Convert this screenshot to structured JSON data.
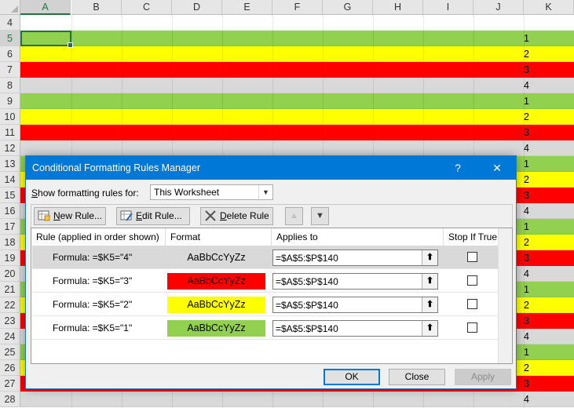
{
  "spreadsheet": {
    "columns": [
      "A",
      "B",
      "C",
      "D",
      "E",
      "F",
      "G",
      "H",
      "I",
      "J",
      "K"
    ],
    "selected_column": "A",
    "selected_row": "5",
    "rows": [
      {
        "num": "4",
        "fill": "#ffffff",
        "k": ""
      },
      {
        "num": "5",
        "fill": "#92d050",
        "k": "1"
      },
      {
        "num": "6",
        "fill": "#ffff00",
        "k": "2"
      },
      {
        "num": "7",
        "fill": "#ff0000",
        "k": "3"
      },
      {
        "num": "8",
        "fill": "#d9d9d9",
        "k": "4"
      },
      {
        "num": "9",
        "fill": "#92d050",
        "k": "1"
      },
      {
        "num": "10",
        "fill": "#ffff00",
        "k": "2"
      },
      {
        "num": "11",
        "fill": "#ff0000",
        "k": "3"
      },
      {
        "num": "12",
        "fill": "#d9d9d9",
        "k": "4"
      },
      {
        "num": "13",
        "fill": "#92d050",
        "k": "1"
      },
      {
        "num": "14",
        "fill": "#ffff00",
        "k": "2"
      },
      {
        "num": "15",
        "fill": "#ff0000",
        "k": "3"
      },
      {
        "num": "16",
        "fill": "#d9d9d9",
        "k": "4"
      },
      {
        "num": "17",
        "fill": "#92d050",
        "k": "1"
      },
      {
        "num": "18",
        "fill": "#ffff00",
        "k": "2"
      },
      {
        "num": "19",
        "fill": "#ff0000",
        "k": "3"
      },
      {
        "num": "20",
        "fill": "#d9d9d9",
        "k": "4"
      },
      {
        "num": "21",
        "fill": "#92d050",
        "k": "1"
      },
      {
        "num": "22",
        "fill": "#ffff00",
        "k": "2"
      },
      {
        "num": "23",
        "fill": "#ff0000",
        "k": "3"
      },
      {
        "num": "24",
        "fill": "#d9d9d9",
        "k": "4"
      },
      {
        "num": "25",
        "fill": "#92d050",
        "k": "1"
      },
      {
        "num": "26",
        "fill": "#ffff00",
        "k": "2"
      },
      {
        "num": "27",
        "fill": "#ff0000",
        "k": "3"
      },
      {
        "num": "28",
        "fill": "#d9d9d9",
        "k": "4"
      }
    ]
  },
  "dialog": {
    "title": "Conditional Formatting Rules Manager",
    "help_label": "?",
    "close_label": "✕",
    "show_rules_label_accel": "S",
    "show_rules_label_rest": "how formatting rules for:",
    "show_rules_value": "This Worksheet",
    "toolbar": {
      "new_rule_accel": "N",
      "new_rule_rest": "ew Rule...",
      "edit_rule_accel": "E",
      "edit_rule_rest": "dit Rule...",
      "delete_rule_accel": "D",
      "delete_rule_rest": "elete Rule",
      "move_up": "▲",
      "move_down": "▼"
    },
    "headers": {
      "rule": "Rule (applied in order shown)",
      "format": "Format",
      "applies_to": "Applies to",
      "stop_if_true": "Stop If True"
    },
    "rules": [
      {
        "rule": "Formula: =$K5=\"4\"",
        "preview": "AaBbCcYyZz",
        "fill": "#d9d9d9",
        "applies_to": "=$A$5:$P$140",
        "stop": false,
        "selected": true
      },
      {
        "rule": "Formula: =$K5=\"3\"",
        "preview": "AaBbCcYyZz",
        "fill": "#ff0000",
        "applies_to": "=$A$5:$P$140",
        "stop": false,
        "selected": false
      },
      {
        "rule": "Formula: =$K5=\"2\"",
        "preview": "AaBbCcYyZz",
        "fill": "#ffff00",
        "applies_to": "=$A$5:$P$140",
        "stop": false,
        "selected": false
      },
      {
        "rule": "Formula: =$K5=\"1\"",
        "preview": "AaBbCcYyZz",
        "fill": "#92d050",
        "applies_to": "=$A$5:$P$140",
        "stop": false,
        "selected": false
      }
    ],
    "collapse_icon": "⬆",
    "buttons": {
      "ok": "OK",
      "close": "Close",
      "apply": "Apply"
    }
  }
}
